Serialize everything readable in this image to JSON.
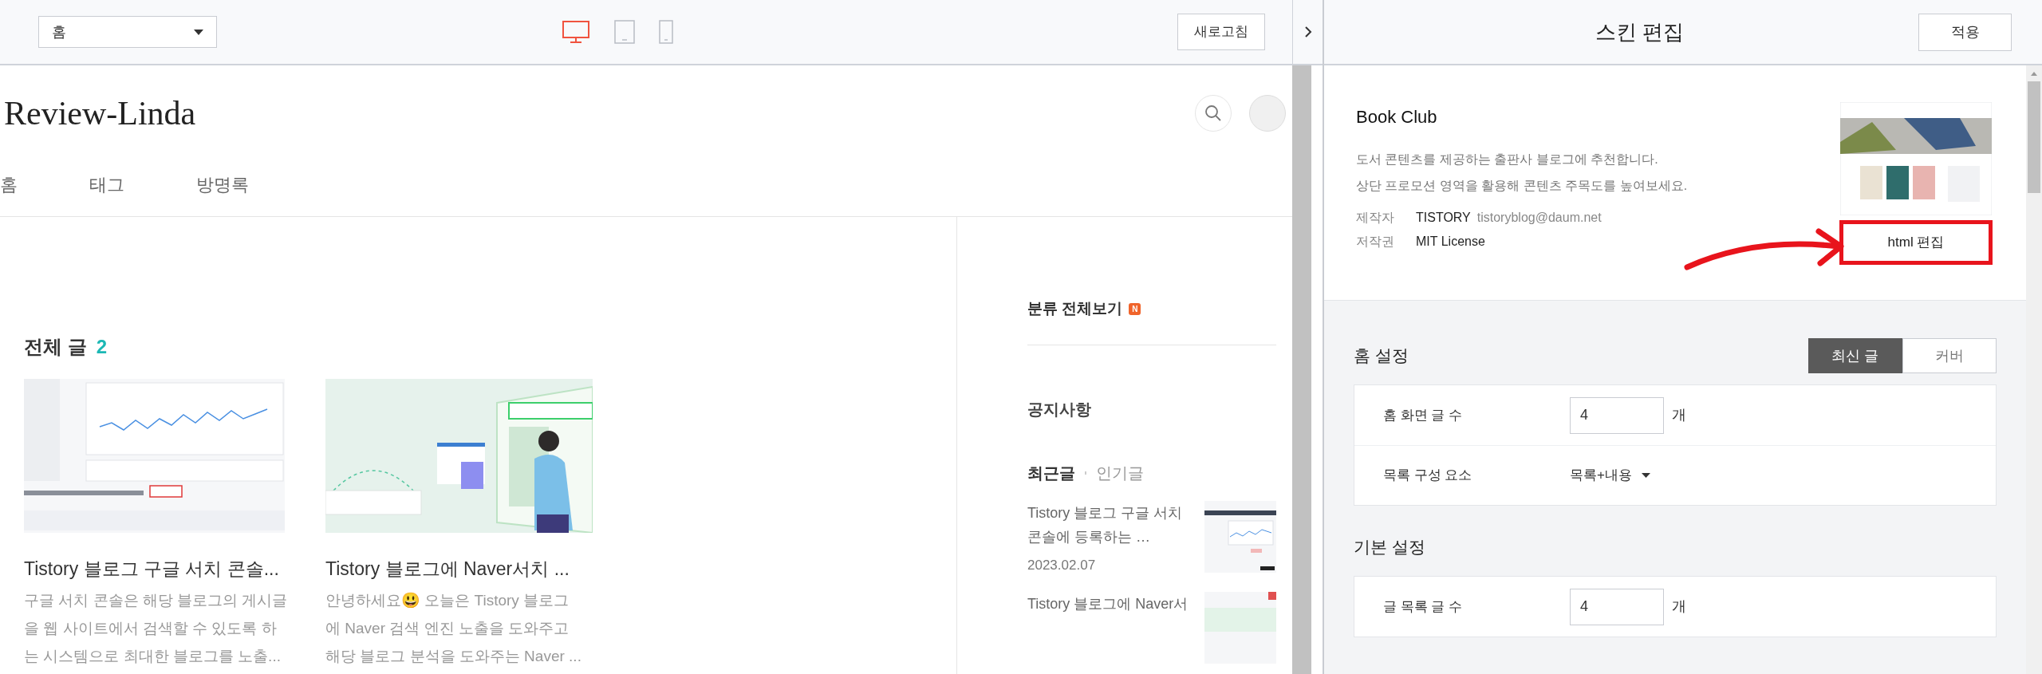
{
  "toolbar": {
    "page_select": "홈",
    "devices": [
      {
        "kind": "desktop",
        "selected": true
      },
      {
        "kind": "tablet",
        "selected": false
      },
      {
        "kind": "mobile",
        "selected": false
      }
    ],
    "refresh_button": "새로고침"
  },
  "blog": {
    "title": "Review-Linda",
    "nav": [
      "홈",
      "태그",
      "방명록"
    ],
    "posts_heading": "전체 글",
    "posts_count": "2",
    "posts": [
      {
        "title": "Tistory 블로그 구글 서치 콘솔...",
        "excerpt": "구글 서치 콘솔은 해당 블로그의 게시글\n을 웹 사이트에서 검색할 수 있도록 하\n는 시스템으로 최대한 블로그를 노출..."
      },
      {
        "title": "Tistory 블로그에 Naver서치 ...",
        "excerpt": "안녕하세요😃 오늘은 Tistory 블로그\n에 Naver 검색 엔진 노출을 도와주고\n해당 블로그 분석을 도와주는 Naver ..."
      }
    ],
    "sidebar": {
      "category_heading": "분류 전체보기",
      "new_badge": "N",
      "notice_heading": "공지사항",
      "tabs": [
        {
          "label": "최근글",
          "selected": true
        },
        {
          "label": "인기글",
          "selected": false
        }
      ],
      "recent": [
        {
          "title": "Tistory 블로그 구글 서치\n콘솔에 등록하는 …",
          "date": "2023.02.07"
        },
        {
          "title": "Tistory 블로그에 Naver서"
        }
      ]
    }
  },
  "editor": {
    "title": "스킨 편집",
    "apply_button": "적용",
    "skin": {
      "name": "Book Club",
      "description": "도서 콘텐츠를 제공하는 출판사 블로그에 추천합니다.\n상단 프로모션 영역을 활용해 콘텐츠 주목도를 높여보세요.",
      "meta": [
        {
          "label": "제작자",
          "value": "TISTORY",
          "extra": "tistoryblog@daum.net"
        },
        {
          "label": "저작권",
          "value": "MIT License"
        }
      ],
      "html_edit_button": "html 편집"
    },
    "sections": [
      {
        "title": "홈 설정",
        "toggle": [
          {
            "label": "최신 글",
            "selected": true
          },
          {
            "label": "커버",
            "selected": false
          }
        ],
        "rows": [
          {
            "kind": "number",
            "label": "홈 화면 글 수",
            "value": "4",
            "unit": "개"
          },
          {
            "kind": "select",
            "label": "목록 구성 요소",
            "value": "목록+내용"
          }
        ]
      },
      {
        "title": "기본 설정",
        "rows": [
          {
            "kind": "number",
            "label": "글 목록 글 수",
            "value": "4",
            "unit": "개"
          }
        ]
      }
    ]
  }
}
